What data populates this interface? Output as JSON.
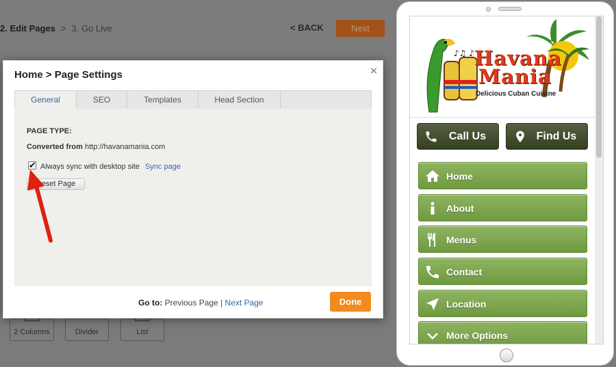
{
  "wizard": {
    "steps": [
      {
        "label": "2. Edit Pages"
      },
      {
        "separator": ">"
      },
      {
        "label": "3. Go Live"
      }
    ],
    "back_label": "< BACK",
    "next_label": "Next"
  },
  "toolbar": {
    "items": [
      {
        "label": "2 Columns"
      },
      {
        "label": "Divider"
      },
      {
        "label": "List"
      }
    ]
  },
  "modal": {
    "title": "Home > Page Settings",
    "close_symbol": "×",
    "tabs": [
      {
        "label": "General",
        "active": true
      },
      {
        "label": "SEO",
        "active": false
      },
      {
        "label": "Templates",
        "active": false
      },
      {
        "label": "Head Section",
        "active": false
      }
    ],
    "page_type_label": "PAGE TYPE:",
    "converted_from_label": "Converted from",
    "converted_from_url": "http://havanamania.com",
    "sync_checked": true,
    "sync_label": "Always sync with desktop site",
    "sync_link": "Sync page",
    "reset_label": "Reset Page",
    "goto_label": "Go to:",
    "prev_link": "Previous Page",
    "goto_separator": "|",
    "next_link": "Next Page",
    "done_label": "Done"
  },
  "preview": {
    "logo_line1": "Havana",
    "logo_line2": "Mania",
    "logo_tagline": "Delicious Cuban Cuisine",
    "call_label": "Call Us",
    "find_label": "Find Us",
    "menu": [
      {
        "label": "Home",
        "icon": "home-icon"
      },
      {
        "label": "About",
        "icon": "info-icon"
      },
      {
        "label": "Menus",
        "icon": "utensils-icon"
      },
      {
        "label": "Contact",
        "icon": "phone-icon"
      },
      {
        "label": "Location",
        "icon": "location-arrow-icon"
      },
      {
        "label": "More Options",
        "icon": "chevron-down-icon"
      }
    ]
  },
  "colors": {
    "accent_orange": "#f28a1e",
    "menu_green": "#7ea74e",
    "dark_button": "#3f4a2a",
    "link_blue": "#3266a8",
    "annotation_red": "#e02010"
  }
}
